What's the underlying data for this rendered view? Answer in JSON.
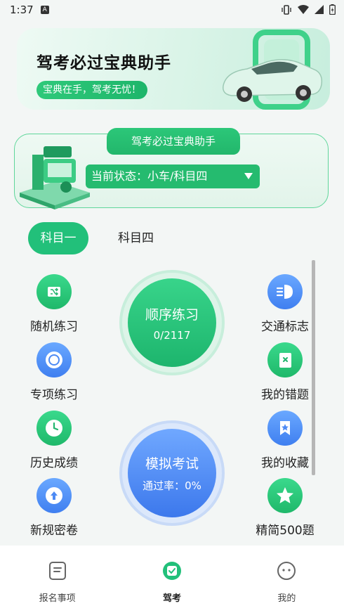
{
  "status_bar": {
    "time": "1:37",
    "notif_badge": "A"
  },
  "banner": {
    "title": "驾考必过宝典助手",
    "subtitle": "宝典在手，驾考无忧！"
  },
  "status_card": {
    "tab_label": "驾考必过宝典助手",
    "current_status": "当前状态：小车/科目四"
  },
  "subject_tabs": [
    {
      "label": "科目一",
      "active": true
    },
    {
      "label": "科目四",
      "active": false
    }
  ],
  "left_features": [
    {
      "label": "随机练习",
      "icon": "shuffle-icon"
    },
    {
      "label": "专项练习",
      "icon": "target-icon"
    },
    {
      "label": "历史成绩",
      "icon": "clock-icon"
    },
    {
      "label": "新规密卷",
      "icon": "upload-icon"
    }
  ],
  "right_features": [
    {
      "label": "交通标志",
      "icon": "headlight-icon"
    },
    {
      "label": "我的错题",
      "icon": "wrong-book-icon"
    },
    {
      "label": "我的收藏",
      "icon": "bookmark-star-icon"
    },
    {
      "label": "精简500题",
      "icon": "star-icon"
    }
  ],
  "sequential_practice": {
    "label": "顺序练习",
    "progress": "0/2117"
  },
  "mock_exam": {
    "label": "模拟考试",
    "pass_rate": "通过率：0%"
  },
  "bottom_nav": [
    {
      "label": "报名事项",
      "icon": "document-icon",
      "active": false
    },
    {
      "label": "驾考",
      "icon": "exam-icon",
      "active": true
    },
    {
      "label": "我的",
      "icon": "face-icon",
      "active": false
    }
  ],
  "colors": {
    "primary_green": "#22c07a",
    "primary_blue": "#3f7ff0"
  }
}
